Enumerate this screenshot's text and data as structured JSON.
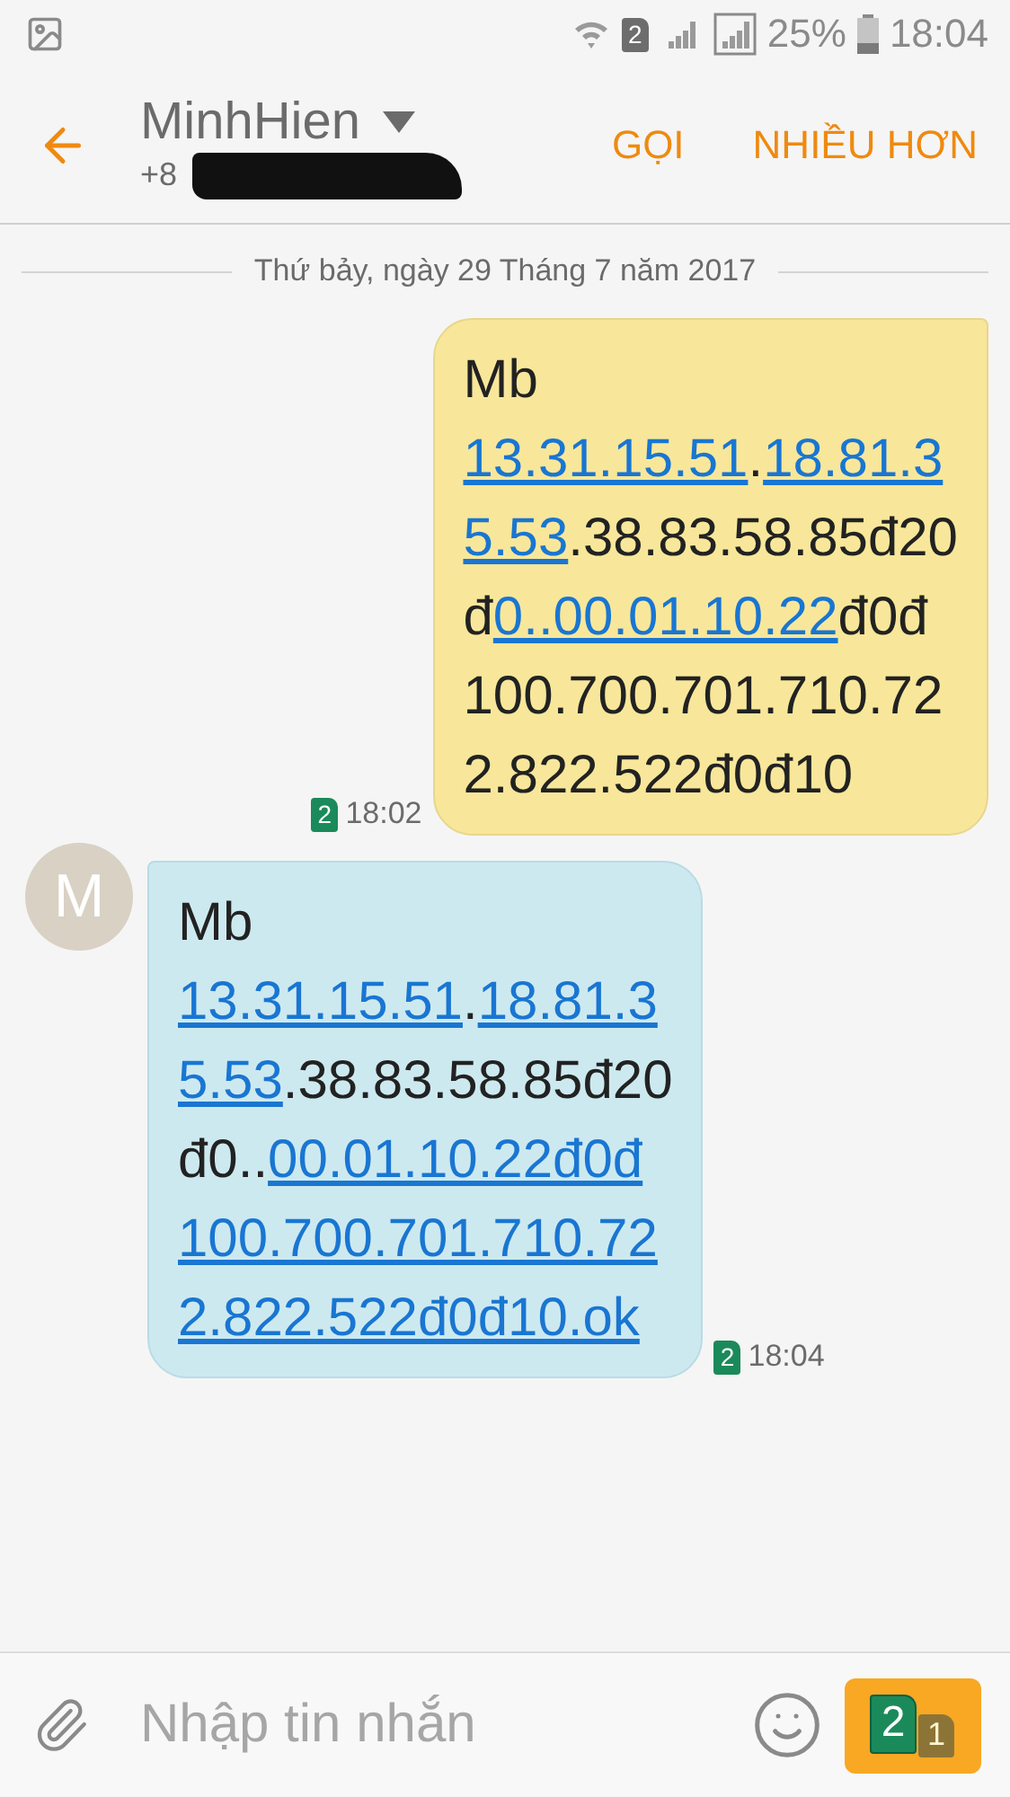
{
  "status_bar": {
    "sim_badge": "2",
    "battery_percent": "25%",
    "time": "18:04"
  },
  "header": {
    "contact_name": "MinhHien",
    "phone_number": "+8",
    "actions": [
      "GỌI",
      "NHIỀU HƠN"
    ]
  },
  "date_divider": "Thứ bảy, ngày 29 Tháng 7 năm 2017",
  "messages": [
    {
      "kind": "sent",
      "sim": "2",
      "time": "18:02",
      "lines": [
        [
          {
            "text": "Mb",
            "link": false
          }
        ],
        [
          {
            "text": "13.31.15.51",
            "link": true
          },
          {
            "text": ".",
            "link": false
          },
          {
            "text": "18.81.3",
            "link": true
          }
        ],
        [
          {
            "text": "5.53",
            "link": true
          },
          {
            "text": ".38.83.58.85đ20",
            "link": false
          }
        ],
        [
          {
            "text": "đ",
            "link": false
          },
          {
            "text": "0..00.01.10.22",
            "link": true
          },
          {
            "text": "đ0đ",
            "link": false
          }
        ],
        [
          {
            "text": "100.700.701.710.72",
            "link": false
          }
        ],
        [
          {
            "text": "2.822.522đ0đ10",
            "link": false
          }
        ]
      ]
    },
    {
      "kind": "received",
      "avatar": "M",
      "sim": "2",
      "time": "18:04",
      "lines": [
        [
          {
            "text": "Mb",
            "link": false
          }
        ],
        [
          {
            "text": "13.31.15.51",
            "link": true
          },
          {
            "text": ".",
            "link": false
          },
          {
            "text": "18.81.3",
            "link": true
          }
        ],
        [
          {
            "text": "5.53",
            "link": true
          },
          {
            "text": ".38.83.58.85đ20",
            "link": false
          }
        ],
        [
          {
            "text": "đ0..",
            "link": false
          },
          {
            "text": "00.01.10.22đ0đ",
            "link": true
          }
        ],
        [
          {
            "text": "100.700.701.710.72",
            "link": true
          }
        ],
        [
          {
            "text": "2.822.522đ0đ10.ok",
            "link": true
          }
        ]
      ]
    }
  ],
  "composer": {
    "placeholder": "Nhập tin nhắn",
    "send_sims": [
      "2",
      "1"
    ]
  }
}
